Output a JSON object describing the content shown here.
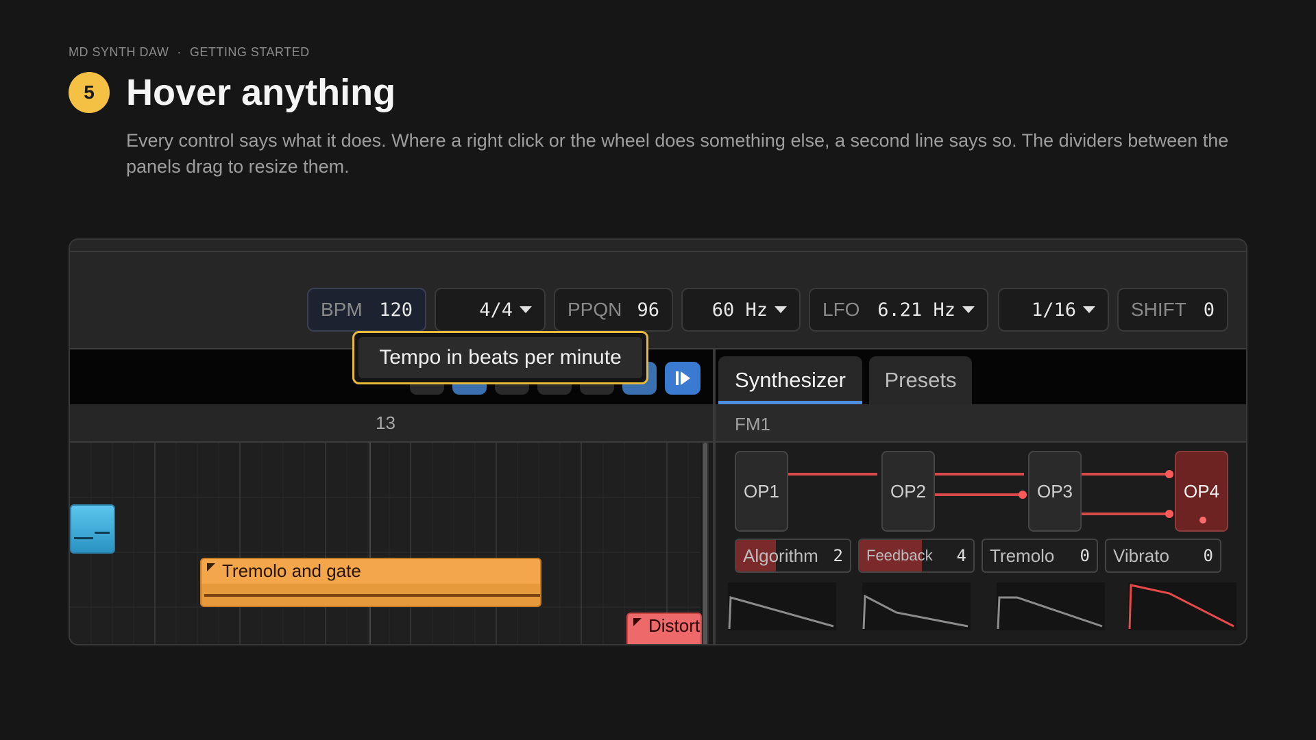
{
  "header": {
    "app_name": "MD SYNTH DAW",
    "separator": "·",
    "section": "GETTING STARTED",
    "step_number": "5",
    "title": "Hover anything",
    "description": "Every control says what it does. Where a right click or the wheel does something else, a second line says so. The dividers between the panels drag to resize them."
  },
  "toolbar": {
    "bpm": {
      "label": "BPM",
      "value": "120"
    },
    "time_signature": {
      "value": "4/4"
    },
    "ppqn": {
      "label": "PPQN",
      "value": "96"
    },
    "rate": {
      "value": "60 Hz"
    },
    "lfo": {
      "label": "LFO",
      "value": "6.21 Hz"
    },
    "quantize": {
      "value": "1/16"
    },
    "shift": {
      "label": "SHIFT",
      "value": "0"
    }
  },
  "tooltip": {
    "text": "Tempo in beats per minute"
  },
  "timeline": {
    "ruler_label": "13",
    "clips": [
      {
        "name": ""
      },
      {
        "name": "Tremolo and gate"
      },
      {
        "name": "Distort"
      }
    ]
  },
  "synth_panel": {
    "tabs": [
      {
        "label": "Synthesizer",
        "active": true
      },
      {
        "label": "Presets",
        "active": false
      }
    ],
    "patch_name": "FM1",
    "operators": [
      "OP1",
      "OP2",
      "OP3",
      "OP4"
    ],
    "params": [
      {
        "label": "Algorithm",
        "value": "2",
        "level": 0.35
      },
      {
        "label": "Feedback",
        "value": "4",
        "level": 0.55
      },
      {
        "label": "Tremolo",
        "value": "0",
        "level": 0
      },
      {
        "label": "Vibrato",
        "value": "0",
        "level": 0
      }
    ]
  },
  "colors": {
    "accent_yellow": "#f5c145",
    "accent_blue": "#4a8fe0",
    "accent_red": "#e04848",
    "clip_orange": "#f3a74a",
    "clip_blue": "#4cb8e6"
  }
}
